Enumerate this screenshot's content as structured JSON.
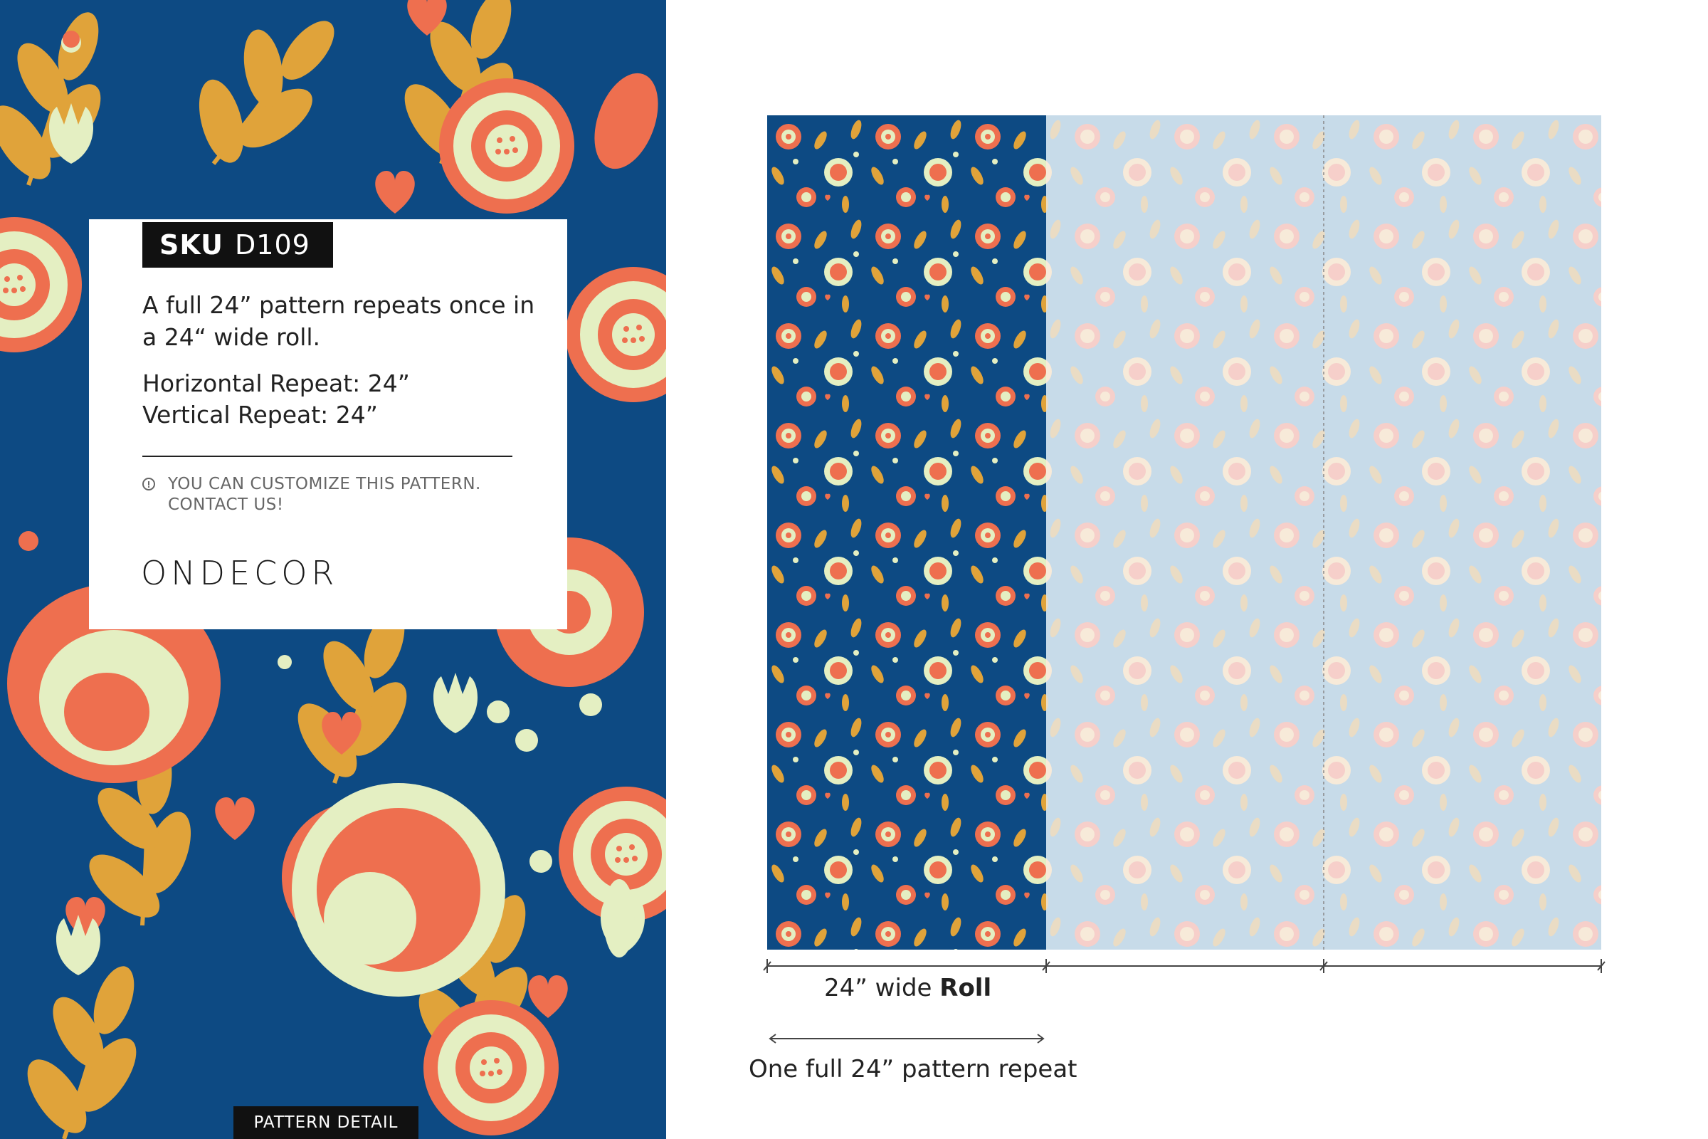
{
  "pattern_detail": {
    "sku_key": "SKU",
    "sku_value": "D109",
    "description": "A full 24” pattern repeats once in a 24“ wide roll.",
    "horizontal_repeat": "Horizontal Repeat: 24”",
    "vertical_repeat": "Vertical Repeat: 24”",
    "notice_line1": "YOU CAN CUSTOMIZE THIS PATTERN.",
    "notice_line2": "CONTACT US!",
    "brand": "ONDECOR",
    "tab_label": "PATTERN DETAIL"
  },
  "roll_preview": {
    "roll_width_text": "24” wide",
    "roll_word": "Roll",
    "repeat_text": "One full 24” pattern repeat"
  },
  "colors": {
    "navy": "#0d4a83",
    "coral": "#ee6f4f",
    "mustard": "#e0a33a",
    "cream": "#e4efc2",
    "faded_blue": "#c7dbe9",
    "faded_pink": "#f6cfca"
  }
}
